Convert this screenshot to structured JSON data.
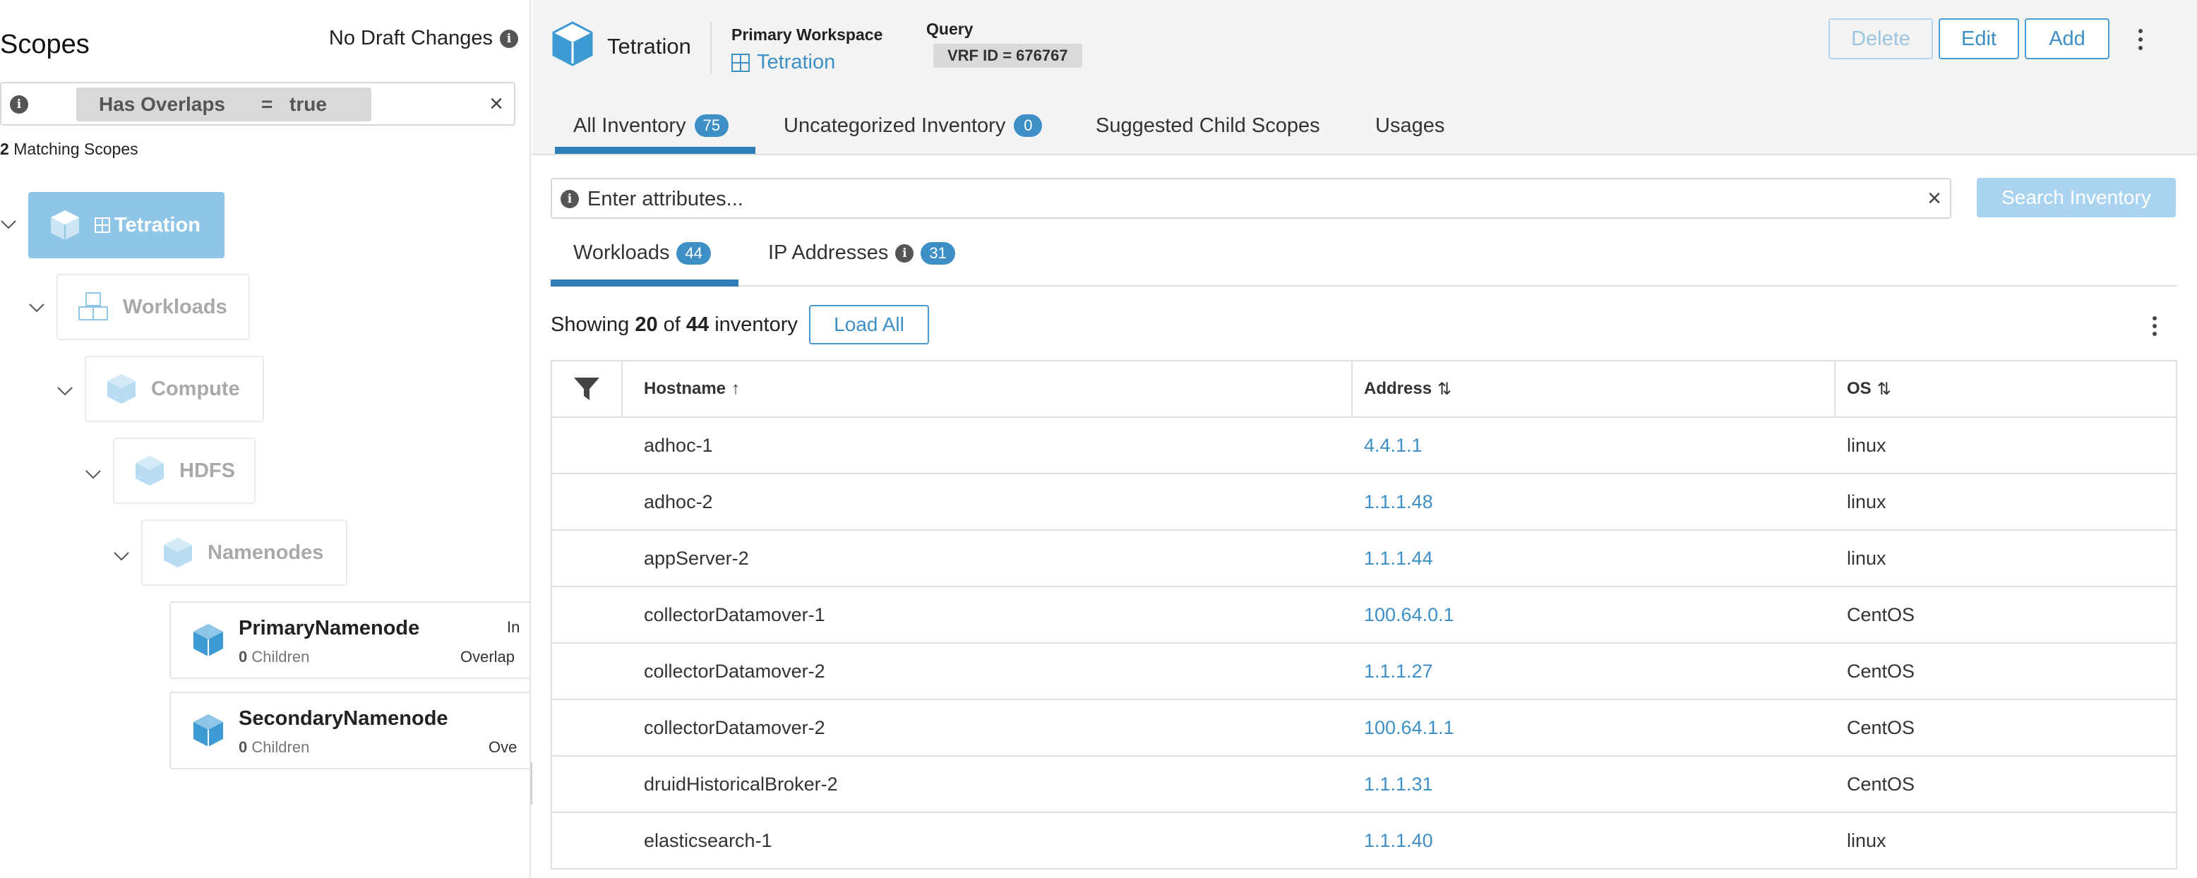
{
  "left": {
    "title": "Scopes",
    "draft_status": "No Draft Changes",
    "filter": {
      "key": "Has Overlaps",
      "operator": "=",
      "value": "true"
    },
    "matching_count": "2",
    "matching_label": "Matching Scopes",
    "tree": {
      "root": "Tetration",
      "workloads": "Workloads",
      "compute": "Compute",
      "hdfs": "HDFS",
      "namenodes": "Namenodes"
    },
    "leaves": [
      {
        "name": "PrimaryNamenode",
        "children_count": "0",
        "children_label": "Children",
        "tag1": "In",
        "tag2": "Overlap"
      },
      {
        "name": "SecondaryNamenode",
        "children_count": "0",
        "children_label": "Children",
        "tag1": "",
        "tag2": "Ove"
      }
    ]
  },
  "header": {
    "scope_name": "Tetration",
    "workspace_label": "Primary Workspace",
    "workspace_link": "Tetration",
    "query_label": "Query",
    "query_value": "VRF ID = 676767",
    "buttons": {
      "delete": "Delete",
      "edit": "Edit",
      "add": "Add"
    }
  },
  "tabs": {
    "all": {
      "label": "All Inventory",
      "count": "75"
    },
    "uncategorized": {
      "label": "Uncategorized Inventory",
      "count": "0"
    },
    "suggested": {
      "label": "Suggested Child Scopes"
    },
    "usages": {
      "label": "Usages"
    }
  },
  "search": {
    "placeholder": "Enter attributes...",
    "button": "Search Inventory"
  },
  "subtabs": {
    "workloads": {
      "label": "Workloads",
      "count": "44"
    },
    "ip": {
      "label": "IP Addresses",
      "count": "31"
    }
  },
  "showing": {
    "prefix": "Showing",
    "shown": "20",
    "of": "of",
    "total": "44",
    "suffix": "inventory",
    "load_all": "Load All"
  },
  "table": {
    "columns": {
      "hostname": "Hostname",
      "address": "Address",
      "os": "OS"
    },
    "sort_icons": {
      "hostname": "↑",
      "address": "⇅",
      "os": "⇅"
    },
    "rows": [
      {
        "hostname": "adhoc-1",
        "address": "4.4.1.1",
        "os": "linux"
      },
      {
        "hostname": "adhoc-2",
        "address": "1.1.1.48",
        "os": "linux"
      },
      {
        "hostname": "appServer-2",
        "address": "1.1.1.44",
        "os": "linux"
      },
      {
        "hostname": "collectorDatamover-1",
        "address": "100.64.0.1",
        "os": "CentOS"
      },
      {
        "hostname": "collectorDatamover-2",
        "address": "1.1.1.27",
        "os": "CentOS"
      },
      {
        "hostname": "collectorDatamover-2",
        "address": "100.64.1.1",
        "os": "CentOS"
      },
      {
        "hostname": "druidHistoricalBroker-2",
        "address": "1.1.1.31",
        "os": "CentOS"
      },
      {
        "hostname": "elasticsearch-1",
        "address": "1.1.1.40",
        "os": "linux"
      }
    ]
  },
  "colors": {
    "accent": "#3d8fc6",
    "root_node": "#8fc6e8",
    "search_button": "#a9d3ef"
  }
}
